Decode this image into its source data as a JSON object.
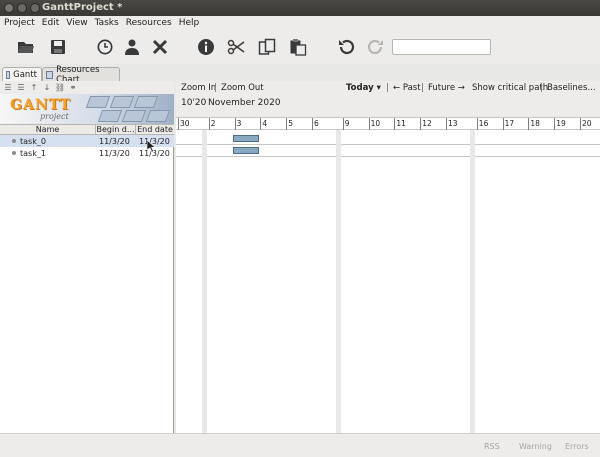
{
  "window": {
    "title": "GanttProject *"
  },
  "menu": [
    "Project",
    "Edit",
    "View",
    "Tasks",
    "Resources",
    "Help"
  ],
  "toolbar": {
    "icons": [
      "open-folder-icon",
      "save-icon",
      "clock-icon",
      "person-icon",
      "delete-x-icon",
      "info-icon",
      "cut-icon",
      "copy-icon",
      "paste-icon",
      "undo-icon",
      "redo-icon"
    ],
    "search_value": ""
  },
  "tabs": [
    {
      "label": "Gantt",
      "active": true
    },
    {
      "label": "Resources Chart",
      "active": false
    }
  ],
  "logo": {
    "word": "GANTT",
    "sub": "project"
  },
  "table": {
    "columns": [
      "Name",
      "Begin d...",
      "End date"
    ],
    "rows": [
      {
        "name": "task_0",
        "begin": "11/3/20",
        "end": "11/3/20",
        "selected": true
      },
      {
        "name": "task_1",
        "begin": "11/3/20",
        "end": "11/3/20",
        "selected": false
      }
    ]
  },
  "chart_toolbar": {
    "zoom_in": "Zoom In",
    "zoom_out": "Zoom Out",
    "today": "Today",
    "past": "← Past",
    "future": "Future →",
    "critical": "Show critical path",
    "baselines": "Baselines..."
  },
  "timeline": {
    "year_label": "10'20",
    "month_label": "November 2020",
    "days": [
      "30",
      "2",
      "3",
      "4",
      "5",
      "6",
      "9",
      "10",
      "11",
      "12",
      "13",
      "16",
      "17",
      "18",
      "19",
      "20"
    ]
  },
  "statusbar": [
    "RSS",
    "Warning",
    "Errors"
  ]
}
